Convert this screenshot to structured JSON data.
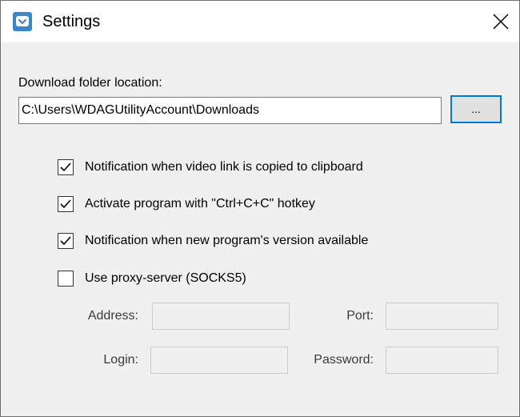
{
  "window": {
    "title": "Settings",
    "icon": "pocket-icon",
    "close_icon": "close-icon"
  },
  "download": {
    "label": "Download folder location:",
    "path": "C:\\Users\\WDAGUtilityAccount\\Downloads",
    "browse_label": "..."
  },
  "options": [
    {
      "label": "Notification when video link is copied to clipboard",
      "checked": true
    },
    {
      "label": "Activate program with \"Ctrl+C+C\" hotkey",
      "checked": true
    },
    {
      "label": "Notification when new program's version available",
      "checked": true
    },
    {
      "label": "Use proxy-server (SOCKS5)",
      "checked": false
    }
  ],
  "proxy": {
    "address_label": "Address:",
    "address_value": "",
    "port_label": "Port:",
    "port_value": "",
    "login_label": "Login:",
    "login_value": "",
    "password_label": "Password:",
    "password_value": ""
  },
  "colors": {
    "accent": "#0078d7",
    "icon_blue": "#3a86c8",
    "window_bg": "#f0f0f0"
  }
}
